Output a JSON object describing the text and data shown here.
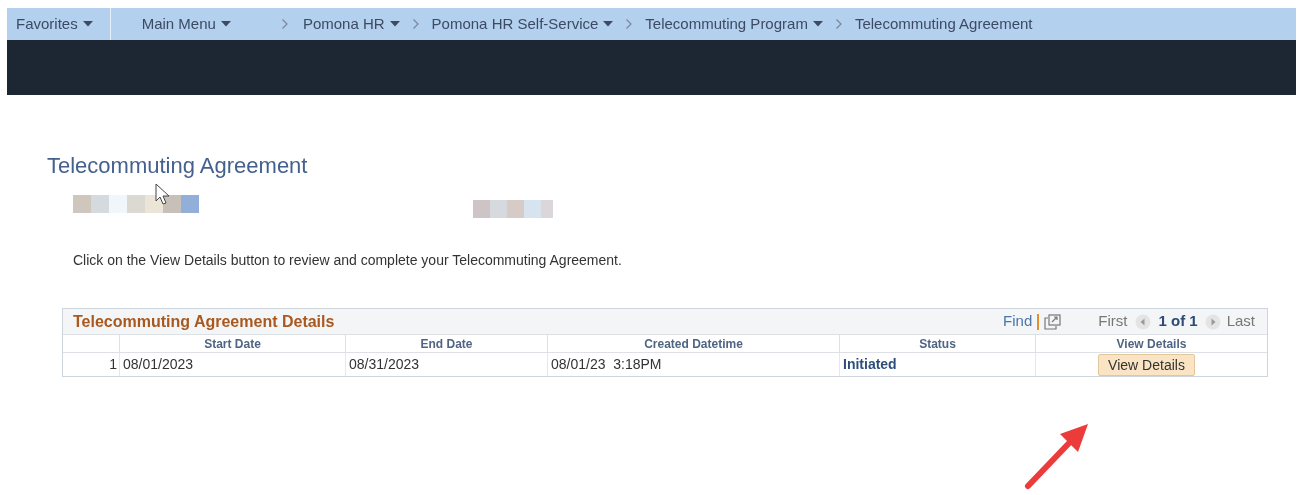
{
  "breadcrumb": [
    {
      "label": "Favorites",
      "kind": "menu"
    },
    {
      "label": "Main Menu",
      "kind": "menu"
    },
    {
      "label": "Pomona HR",
      "kind": "menu"
    },
    {
      "label": "Pomona HR Self-Service",
      "kind": "menu"
    },
    {
      "label": "Telecommuting Program",
      "kind": "menu"
    },
    {
      "label": "Telecommuting Agreement",
      "kind": "current"
    }
  ],
  "page_title": "Telecommuting Agreement",
  "instructions": "Click on the View Details button to review and complete your Telecommuting Agreement.",
  "grid": {
    "title": "Telecommuting Agreement Details",
    "find": "Find",
    "first": "First",
    "counter": "1 of 1",
    "last": "Last",
    "columns": [
      "Start Date",
      "End Date",
      "Created Datetime",
      "Status",
      "View Details"
    ],
    "rows": [
      {
        "number": "1",
        "start_date": "08/01/2023",
        "end_date": "08/31/2023",
        "created": "08/01/23  3:18PM",
        "status": "Initiated",
        "button": "View Details"
      }
    ]
  }
}
